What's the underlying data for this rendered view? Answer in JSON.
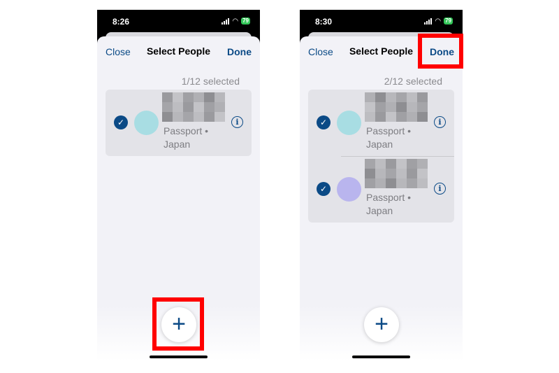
{
  "screens": [
    {
      "time": "8:26",
      "battery": "79",
      "nav": {
        "close": "Close",
        "title": "Select People",
        "done": "Done"
      },
      "selected_count": "1/12 selected",
      "people": [
        {
          "subtitle_line1": "Passport •",
          "subtitle_line2": "Japan",
          "avatar_color": "#a8dde3",
          "checked": true
        }
      ],
      "add_button": "+",
      "highlight": "add-button"
    },
    {
      "time": "8:30",
      "battery": "79",
      "nav": {
        "close": "Close",
        "title": "Select People",
        "done": "Done"
      },
      "selected_count": "2/12 selected",
      "people": [
        {
          "subtitle_line1": "Passport •",
          "subtitle_line2": "Japan",
          "avatar_color": "#a8dde3",
          "checked": true
        },
        {
          "subtitle_line1": "Passport •",
          "subtitle_line2": "Japan",
          "avatar_color": "#b9b5ee",
          "checked": true
        }
      ],
      "add_button": "+",
      "highlight": "done-button"
    }
  ],
  "colors": {
    "accent": "#0b4a86",
    "highlight": "#ff0000",
    "background": "#f2f2f7"
  }
}
